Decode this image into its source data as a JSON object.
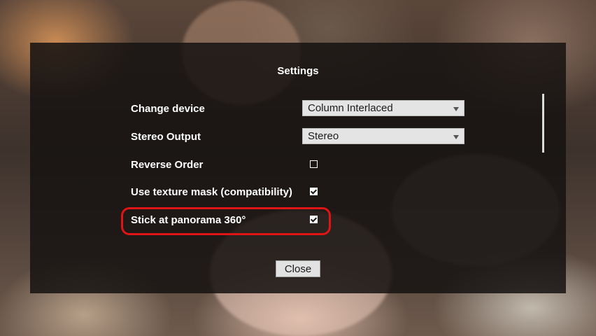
{
  "dialog": {
    "title": "Settings",
    "change_device": {
      "label": "Change device",
      "selected": "Column Interlaced"
    },
    "stereo_output": {
      "label": "Stereo Output",
      "selected": "Stereo"
    },
    "reverse_order": {
      "label": "Reverse Order",
      "checked": false
    },
    "texture_mask": {
      "label": "Use texture mask (compatibility)",
      "checked": true
    },
    "stick_panorama": {
      "label": "Stick at panorama 360°",
      "checked": true
    },
    "close_label": "Close"
  },
  "colors": {
    "highlight": "#e01414",
    "dialog_bg": "#161312"
  }
}
